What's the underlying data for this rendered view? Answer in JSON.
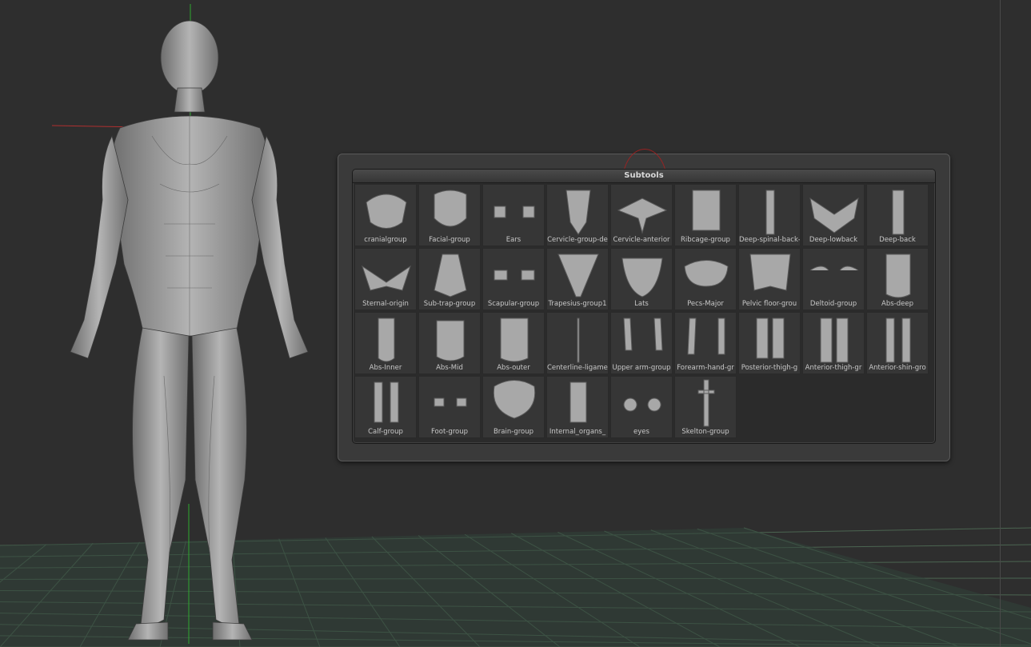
{
  "subtools": {
    "title": "Subtools",
    "items": [
      {
        "label": "cranialgroup",
        "icon": "skull-cap-thumbnail"
      },
      {
        "label": "Facial-group",
        "icon": "face-muscle-thumbnail"
      },
      {
        "label": "Ears",
        "icon": "ears-thumbnail"
      },
      {
        "label": "Cervicle-group-de",
        "icon": "cervical-muscles-thumbnail"
      },
      {
        "label": "Cervicle-anterior",
        "icon": "cervical-anterior-thumbnail"
      },
      {
        "label": "Ribcage-group",
        "icon": "ribcage-thumbnail"
      },
      {
        "label": "Deep-spinal-back-",
        "icon": "spinal-muscles-thumbnail"
      },
      {
        "label": "Deep-lowback",
        "icon": "lowback-thumbnail"
      },
      {
        "label": "Deep-back",
        "icon": "deep-back-thumbnail"
      },
      {
        "label": "Sternal-origin",
        "icon": "sternal-thumbnail"
      },
      {
        "label": "Sub-trap-group",
        "icon": "sub-trap-thumbnail"
      },
      {
        "label": "Scapular-group",
        "icon": "scapular-thumbnail"
      },
      {
        "label": "Trapesius-group1",
        "icon": "trapezius-thumbnail"
      },
      {
        "label": "Lats",
        "icon": "lats-thumbnail"
      },
      {
        "label": "Pecs-Major",
        "icon": "pecs-thumbnail"
      },
      {
        "label": "Pelvic floor-grou",
        "icon": "pelvic-floor-thumbnail"
      },
      {
        "label": "Deltoid-group",
        "icon": "deltoid-thumbnail"
      },
      {
        "label": "Abs-deep",
        "icon": "abs-deep-thumbnail"
      },
      {
        "label": "Abs-Inner",
        "icon": "abs-inner-thumbnail"
      },
      {
        "label": "Abs-Mid",
        "icon": "abs-mid-thumbnail"
      },
      {
        "label": "Abs-outer",
        "icon": "abs-outer-thumbnail"
      },
      {
        "label": "Centerline-ligamen",
        "icon": "centerline-ligament-thumbnail"
      },
      {
        "label": "Upper arm-group",
        "icon": "upper-arm-thumbnail"
      },
      {
        "label": "Forearm-hand-gr",
        "icon": "forearm-hand-thumbnail"
      },
      {
        "label": "Posterior-thigh-g",
        "icon": "posterior-thigh-thumbnail"
      },
      {
        "label": "Anterior-thigh-gr",
        "icon": "anterior-thigh-thumbnail"
      },
      {
        "label": "Anterior-shin-gro",
        "icon": "anterior-shin-thumbnail"
      },
      {
        "label": "Calf-group",
        "icon": "calf-thumbnail"
      },
      {
        "label": "Foot-group",
        "icon": "foot-thumbnail"
      },
      {
        "label": "Brain-group",
        "icon": "brain-thumbnail"
      },
      {
        "label": "Internal_organs_",
        "icon": "internal-organs-thumbnail"
      },
      {
        "label": "eyes",
        "icon": "eyes-thumbnail"
      },
      {
        "label": "Skelton-group",
        "icon": "skeleton-thumbnail"
      }
    ]
  },
  "colors": {
    "background": "#2e2e2e",
    "floor_grid": "#3a4a3e",
    "model": "#9a9a9a",
    "axis_x": "#b03030",
    "axis_y": "#30b030"
  }
}
